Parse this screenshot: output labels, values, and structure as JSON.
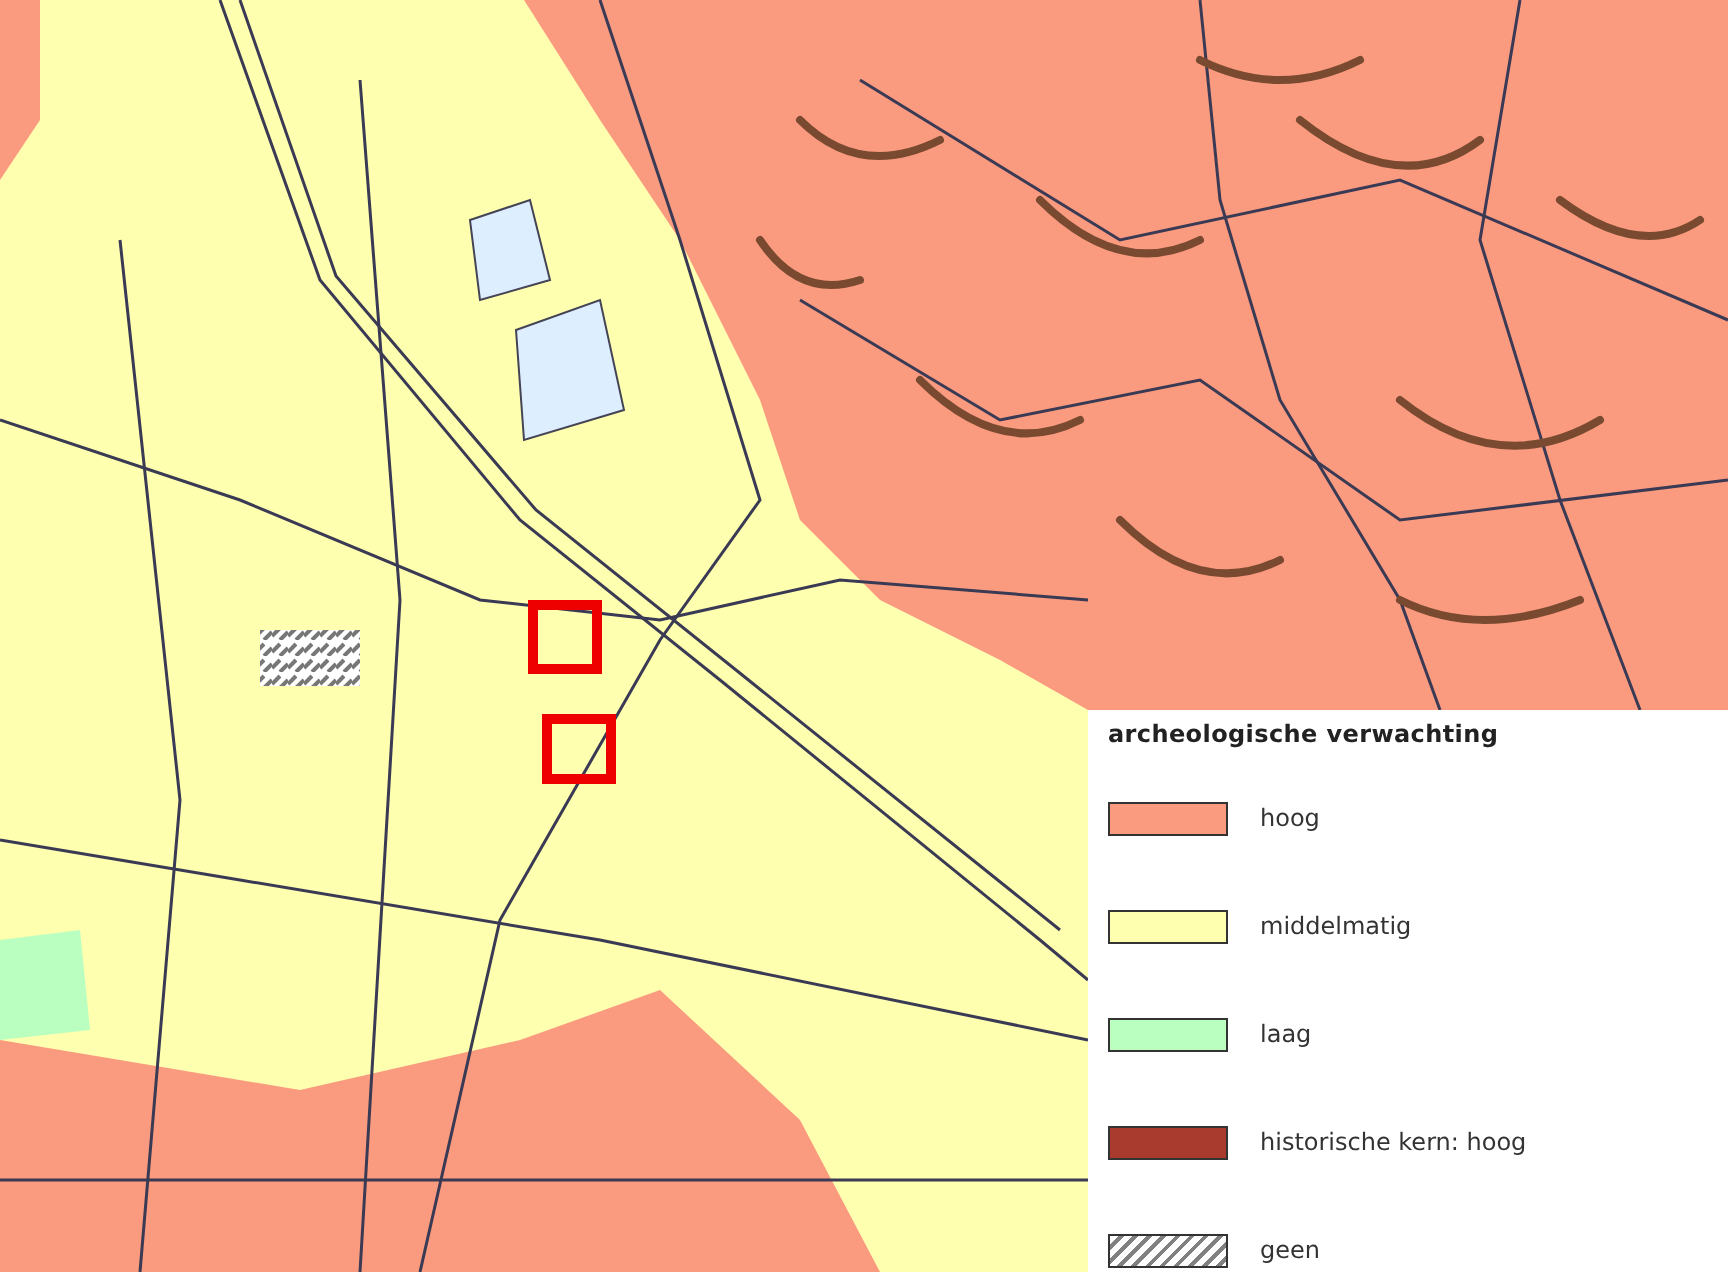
{
  "legend": {
    "title": "archeologische verwachting",
    "items": [
      {
        "label": "hoog",
        "kind": "fill",
        "color": "#fa9b80"
      },
      {
        "label": "middelmatig",
        "kind": "fill",
        "color": "#ffffb0"
      },
      {
        "label": "laag",
        "kind": "fill",
        "color": "#bbffc0"
      },
      {
        "label": "historische kern: hoog",
        "kind": "fill",
        "color": "#a83a2e"
      },
      {
        "label": "geen",
        "kind": "hatch",
        "color": "#808080"
      }
    ]
  }
}
